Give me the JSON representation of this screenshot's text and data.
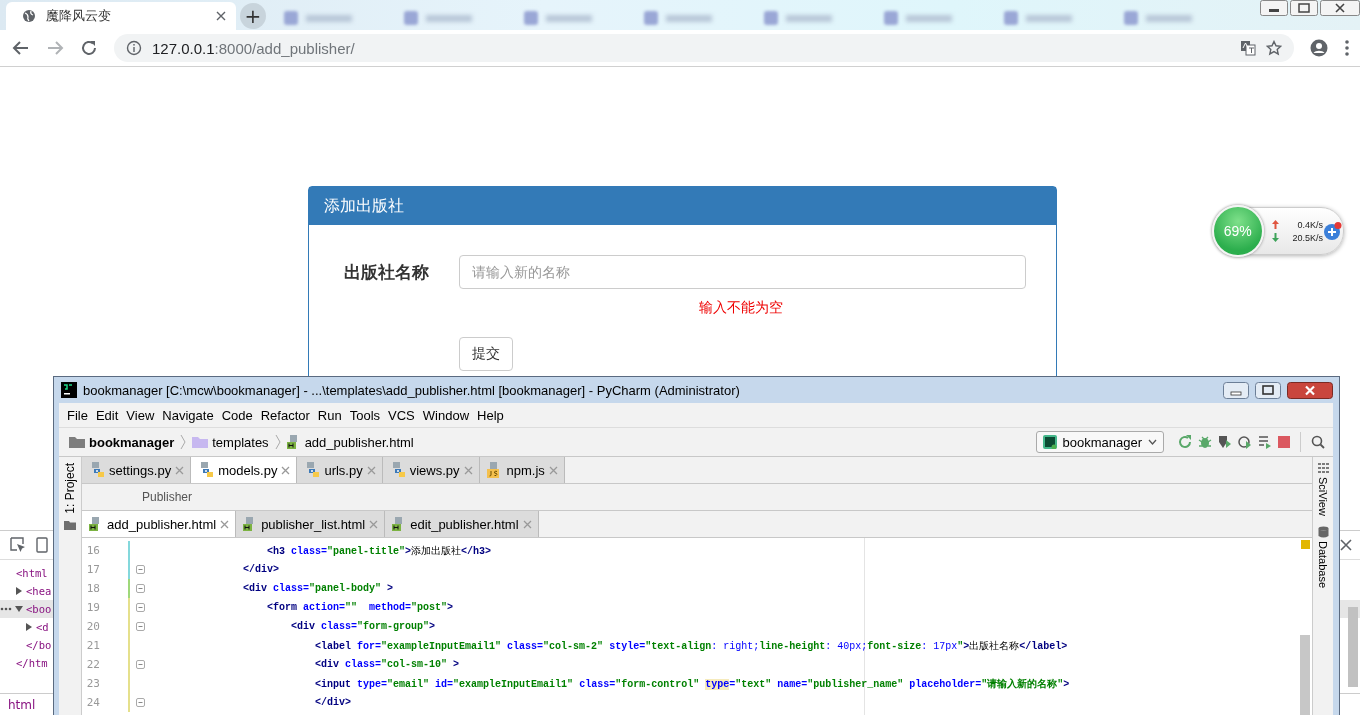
{
  "browser": {
    "tabs": [
      {
        "title": "魔降风云变",
        "selected": true
      }
    ],
    "background_tabs": [
      {
        "kind": "blurred"
      },
      {
        "kind": "blurred"
      },
      {
        "kind": "blurred"
      },
      {
        "kind": "blurred"
      },
      {
        "kind": "blurred"
      },
      {
        "kind": "blurred"
      },
      {
        "kind": "blurred"
      },
      {
        "kind": "blurred"
      }
    ],
    "new_tab": "+",
    "url": {
      "host": "127.0.0.1",
      "path": ":8000/add_publisher/"
    }
  },
  "page": {
    "panel_title": "添加出版社",
    "field_label": "出版社名称",
    "placeholder": "请输入新的名称",
    "error": "输入不能为空",
    "submit": "提交"
  },
  "net_widget": {
    "percent": "69%",
    "upload": "0.4K/s",
    "download": "20.5K/s"
  },
  "devtools": {
    "tree": [
      {
        "text": "<html",
        "close": "</htm",
        "children": [
          {
            "text": "<hea",
            "expanded": false,
            "selected": false
          },
          {
            "text": "<boo",
            "expanded": true,
            "selected": true,
            "close": "</bo",
            "children": [
              {
                "text": "<d",
                "expanded": false,
                "selected": false
              }
            ]
          }
        ]
      }
    ],
    "bottom_tab": "html"
  },
  "ide": {
    "title": "bookmanager [C:\\mcw\\bookmanager] - ...\\templates\\add_publisher.html [bookmanager] - PyCharm (Administrator)",
    "menu": [
      "File",
      "Edit",
      "View",
      "Navigate",
      "Code",
      "Refactor",
      "Run",
      "Tools",
      "VCS",
      "Window",
      "Help"
    ],
    "breadcrumbs": [
      {
        "text": "bookmanager",
        "kind": "project"
      },
      {
        "text": "templates",
        "kind": "folder"
      },
      {
        "text": "add_publisher.html",
        "kind": "html"
      }
    ],
    "run_config": "bookmanager",
    "left_tool": "1: Project",
    "right_tools": [
      "SciView",
      "Database"
    ],
    "tabs": [
      {
        "name": "settings.py",
        "kind": "python",
        "selected": false
      },
      {
        "name": "models.py",
        "kind": "python",
        "selected": true
      },
      {
        "name": "urls.py",
        "kind": "python",
        "selected": false
      },
      {
        "name": "views.py",
        "kind": "python",
        "selected": false
      },
      {
        "name": "npm.js",
        "kind": "js",
        "selected": false
      }
    ],
    "structure_crumb": "Publisher",
    "tabs2": [
      {
        "name": "add_publisher.html",
        "kind": "html",
        "selected": true
      },
      {
        "name": "publisher_list.html",
        "kind": "html",
        "selected": false
      },
      {
        "name": "edit_publisher.html",
        "kind": "html",
        "selected": false
      }
    ],
    "code": [
      {
        "number": "16",
        "fold": false,
        "color": "#84d8dc",
        "segments": [
          {
            "kind": "tag",
            "text": "                    <h3"
          },
          {
            "kind": "attr",
            "text": " class="
          },
          {
            "kind": "str",
            "text": "\"panel-title\""
          },
          {
            "kind": "tag",
            "text": ">"
          },
          {
            "kind": "plain",
            "text": "添加出版社"
          },
          {
            "kind": "tag",
            "text": "</h3>"
          }
        ]
      },
      {
        "number": "17",
        "fold": true,
        "color": "#84d8dc",
        "segments": [
          {
            "kind": "tag",
            "text": "                </div>"
          }
        ]
      },
      {
        "number": "18",
        "fold": true,
        "color": "#9fd87a",
        "segments": [
          {
            "kind": "tag",
            "text": "                <div"
          },
          {
            "kind": "attr",
            "text": " class="
          },
          {
            "kind": "str",
            "text": "\"panel-body\""
          },
          {
            "kind": "tag",
            "text": " >"
          }
        ]
      },
      {
        "number": "19",
        "fold": true,
        "color": "#e5e08c",
        "segments": [
          {
            "kind": "tag",
            "text": "                    <form"
          },
          {
            "kind": "attr",
            "text": " action="
          },
          {
            "kind": "str",
            "text": "\"\""
          },
          {
            "kind": "attr",
            "text": "  method="
          },
          {
            "kind": "str",
            "text": "\"post\""
          },
          {
            "kind": "tag",
            "text": ">"
          }
        ]
      },
      {
        "number": "20",
        "fold": true,
        "color": "#e5e08c",
        "segments": [
          {
            "kind": "tag",
            "text": "                        <div"
          },
          {
            "kind": "attr",
            "text": " class="
          },
          {
            "kind": "str",
            "text": "\"form-group\""
          },
          {
            "kind": "tag",
            "text": ">"
          }
        ]
      },
      {
        "number": "21",
        "fold": false,
        "color": "#e5e08c",
        "segments": [
          {
            "kind": "tag",
            "text": "                            <label"
          },
          {
            "kind": "attr",
            "text": " for="
          },
          {
            "kind": "str",
            "text": "\"exampleInputEmail1\""
          },
          {
            "kind": "attr",
            "text": " class="
          },
          {
            "kind": "str",
            "text": "\"col-sm-2\""
          },
          {
            "kind": "attr",
            "text": " style="
          },
          {
            "kind": "str",
            "text": "\"text-align"
          },
          {
            "kind": "css",
            "text": ": right;"
          },
          {
            "kind": "str",
            "text": "line-height"
          },
          {
            "kind": "css",
            "text": ": 40px;"
          },
          {
            "kind": "str",
            "text": "font-size"
          },
          {
            "kind": "css",
            "text": ": 17px"
          },
          {
            "kind": "str",
            "text": "\""
          },
          {
            "kind": "tag",
            "text": ">"
          },
          {
            "kind": "plain",
            "text": "出版社名称"
          },
          {
            "kind": "tag",
            "text": "</label>"
          }
        ]
      },
      {
        "number": "22",
        "fold": true,
        "color": "#e5e08c",
        "segments": [
          {
            "kind": "tag",
            "text": "                            <div"
          },
          {
            "kind": "attr",
            "text": " class="
          },
          {
            "kind": "str",
            "text": "\"col-sm-10\""
          },
          {
            "kind": "tag",
            "text": " >"
          }
        ]
      },
      {
        "number": "23",
        "fold": false,
        "color": "#e5e08c",
        "segments": [
          {
            "kind": "tag",
            "text": "                            <input"
          },
          {
            "kind": "attr",
            "text": " type="
          },
          {
            "kind": "str",
            "text": "\"email\""
          },
          {
            "kind": "attr",
            "text": " id="
          },
          {
            "kind": "str",
            "text": "\"exampleInputEmail1\""
          },
          {
            "kind": "attr",
            "text": " class="
          },
          {
            "kind": "str",
            "text": "\"form-control\" "
          },
          {
            "kind": "warn",
            "text": "type"
          },
          {
            "kind": "attr",
            "text": "="
          },
          {
            "kind": "str",
            "text": "\"text\""
          },
          {
            "kind": "attr",
            "text": " name="
          },
          {
            "kind": "str",
            "text": "\"publisher_name\""
          },
          {
            "kind": "attr",
            "text": " placeholder="
          },
          {
            "kind": "str",
            "text": "\"请输入新的名称\""
          },
          {
            "kind": "tag",
            "text": ">"
          }
        ]
      },
      {
        "number": "24",
        "fold": true,
        "color": "#e5e08c",
        "segments": [
          {
            "kind": "tag",
            "text": "                            </div>"
          }
        ]
      }
    ]
  }
}
